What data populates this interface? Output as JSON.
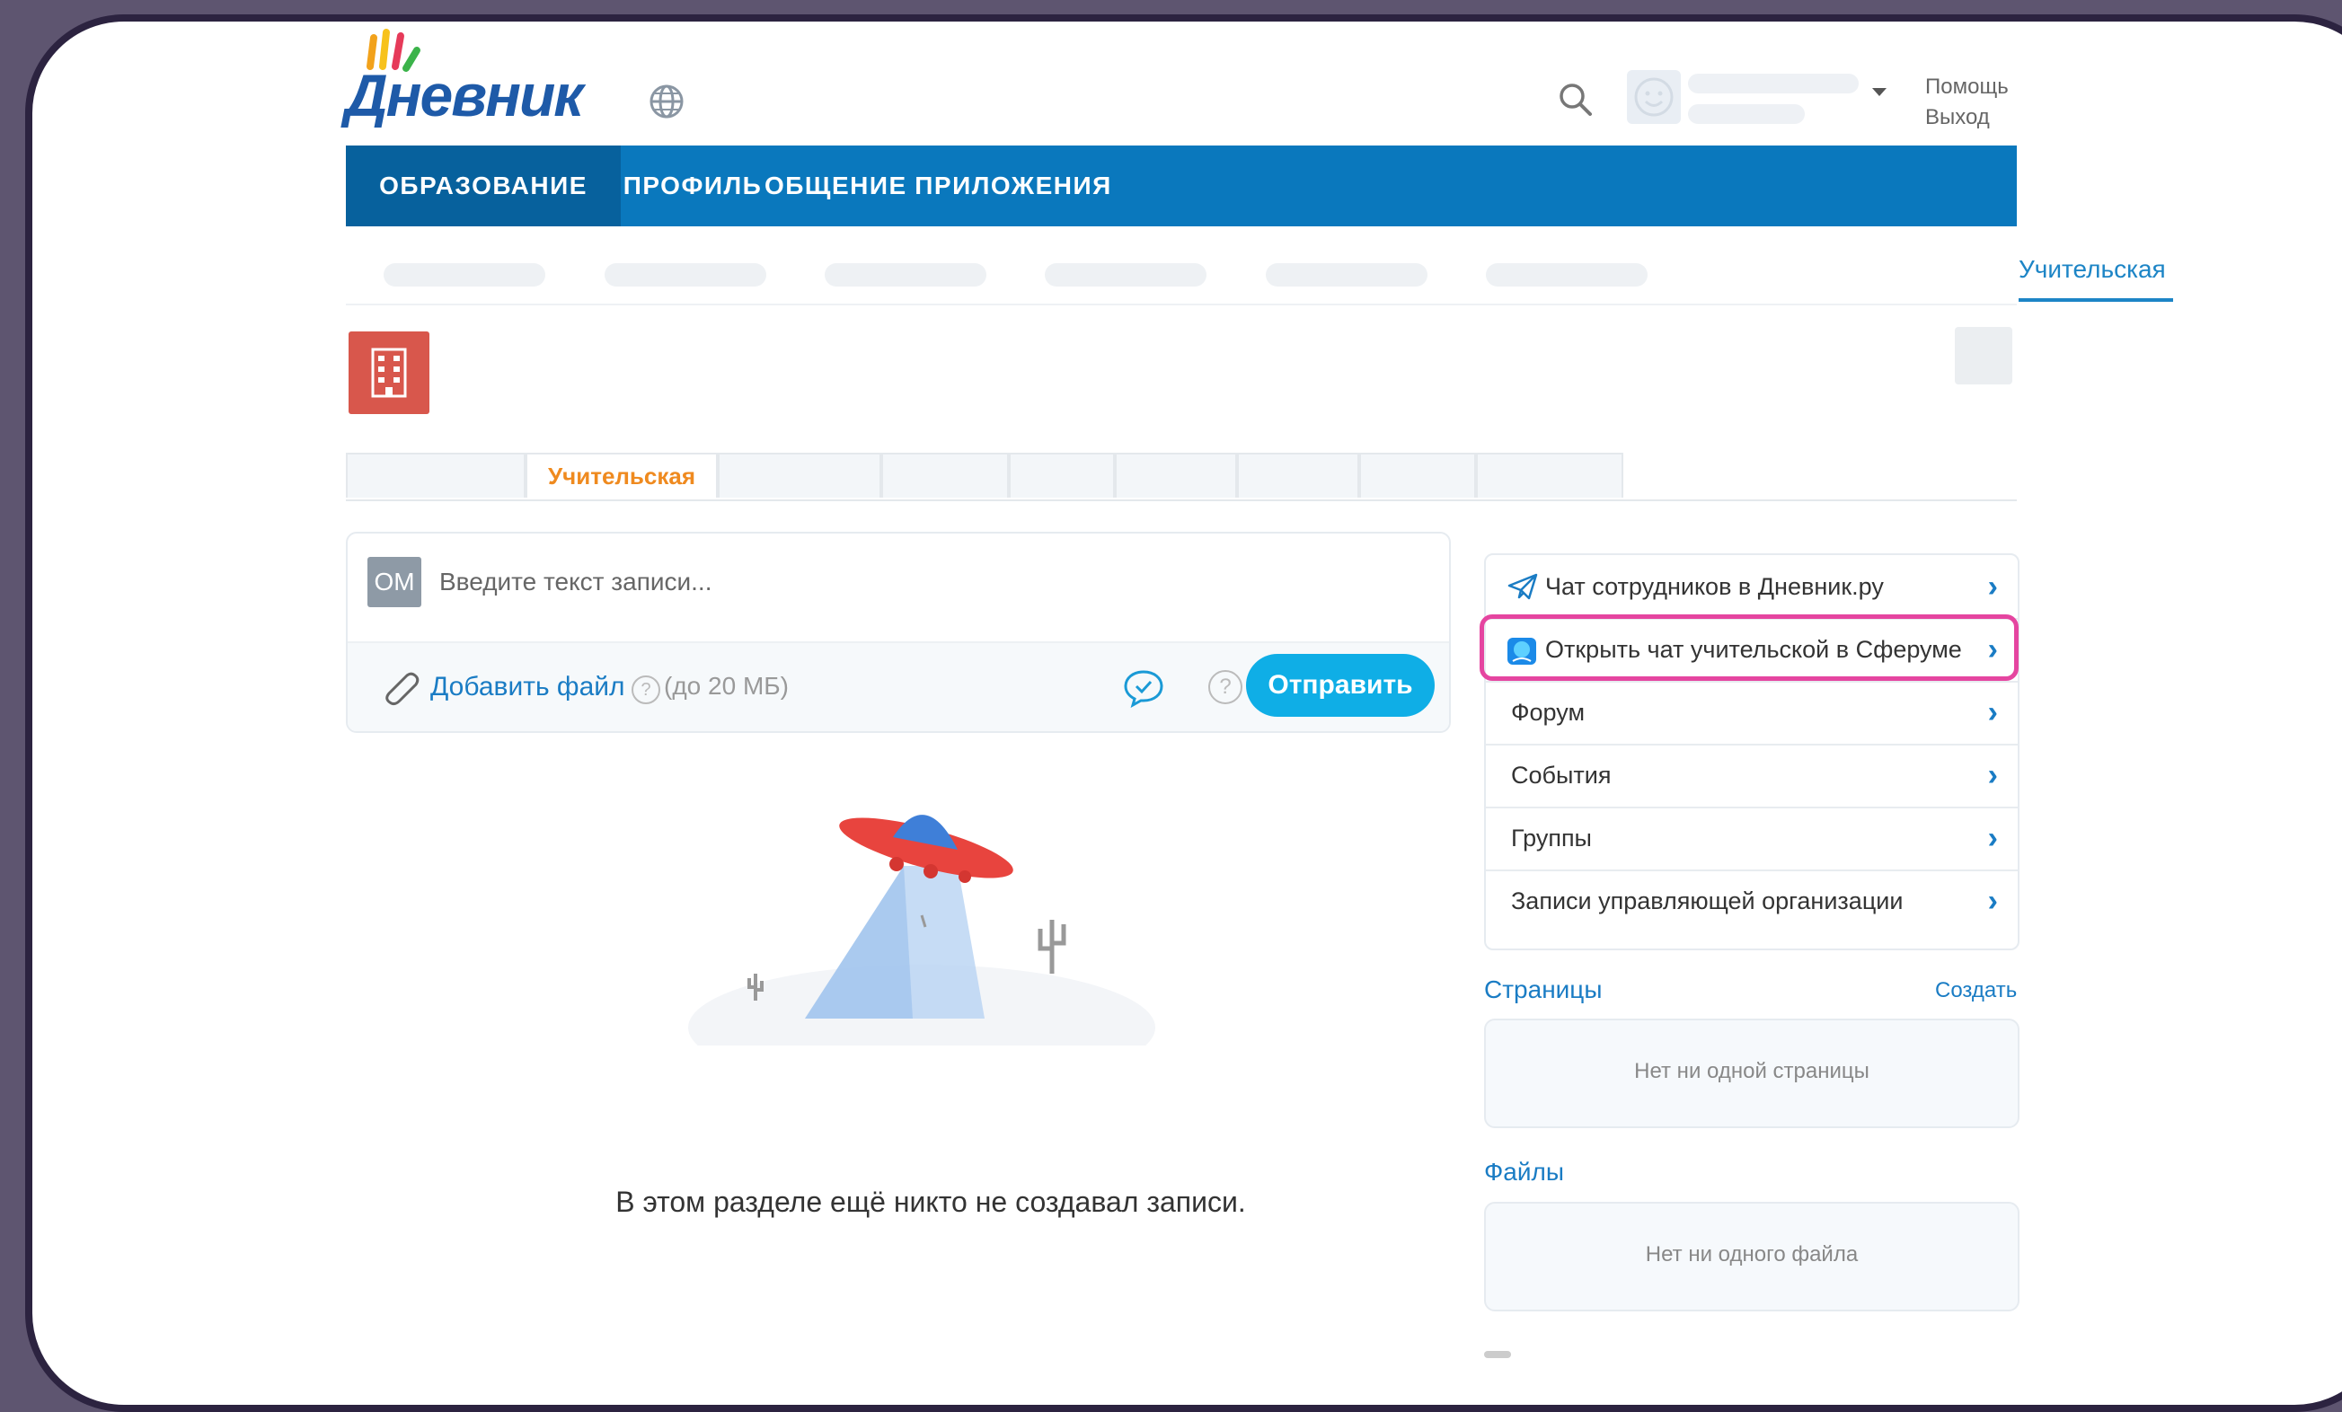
{
  "header": {
    "logo_text": "Дневник",
    "help_link": "Помощь",
    "logout_link": "Выход"
  },
  "nav": {
    "items": [
      {
        "label": "ОБРАЗОВАНИЕ"
      },
      {
        "label": "ПРОФИЛЬ"
      },
      {
        "label": "ОБЩЕНИЕ"
      },
      {
        "label": "ПРИЛОЖЕНИЯ"
      }
    ]
  },
  "subnav": {
    "active_label": "Учительская"
  },
  "tabs": {
    "active_label": "Учительская"
  },
  "composer": {
    "avatar_initials": "ОМ",
    "placeholder": "Введите текст записи...",
    "add_file_label": "Добавить файл",
    "help_glyph": "?",
    "size_note": "(до 20 МБ)",
    "send_label": "Отправить"
  },
  "empty_state": {
    "text": "В этом разделе ещё никто не создавал записи."
  },
  "side_menu": {
    "items": [
      {
        "label": "Чат сотрудников в Дневник.ру",
        "icon": "paper-plane-icon"
      },
      {
        "label": "Открыть чат учительской в Сферуме",
        "icon": "sferum-icon"
      },
      {
        "label": "Форум"
      },
      {
        "label": "События"
      },
      {
        "label": "Группы"
      },
      {
        "label": "Записи управляющей организации"
      }
    ],
    "chevron": "›"
  },
  "pages_section": {
    "title": "Страницы",
    "create_label": "Создать",
    "empty_text": "Нет ни одной страницы"
  },
  "files_section": {
    "title": "Файлы",
    "empty_text": "Нет ни одного файла"
  },
  "colors": {
    "nav_bg": "#0a78bd",
    "nav_active": "#07619d",
    "link": "#1a7cc4",
    "send_button": "#0faee6",
    "highlight": "#e545a0",
    "tab_active": "#ef8a1f"
  }
}
